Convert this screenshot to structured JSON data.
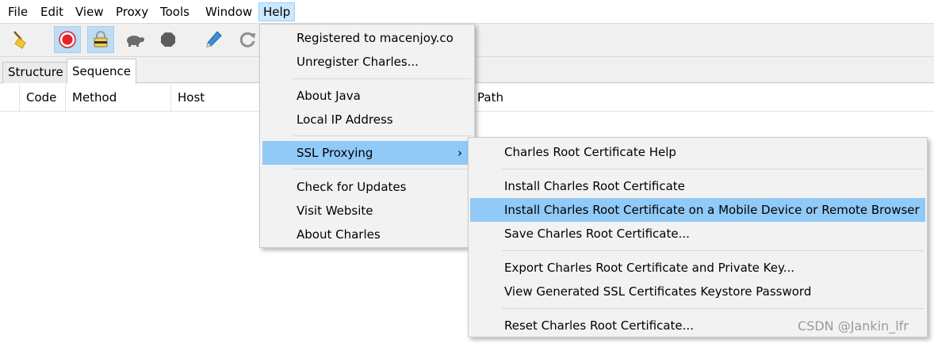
{
  "menubar": {
    "items": [
      "File",
      "Edit",
      "View",
      "Proxy",
      "Tools",
      "Window",
      "Help"
    ],
    "open_item": "Help"
  },
  "toolbar": {
    "buttons": [
      "broom-icon",
      "record-icon",
      "ssl-lock-icon",
      "turtle-icon",
      "hexagon-stop-icon",
      "pen-icon",
      "refresh-icon"
    ]
  },
  "tabs": [
    "Structure",
    "Sequence"
  ],
  "active_tab": "Sequence",
  "table": {
    "columns": [
      "Code",
      "Method",
      "Host",
      "Path"
    ]
  },
  "help_menu": {
    "items": [
      {
        "label": "Registered to macenjoy.co"
      },
      {
        "label": "Unregister Charles..."
      },
      {
        "label": "About Java"
      },
      {
        "label": "Local IP Address"
      },
      {
        "label": "SSL Proxying",
        "submenu_arrow": "›",
        "highlighted": true
      },
      {
        "label": "Check for Updates"
      },
      {
        "label": "Visit Website"
      },
      {
        "label": "About Charles"
      }
    ]
  },
  "ssl_submenu": {
    "items": [
      {
        "label": "Charles Root Certificate Help"
      },
      {
        "label": "Install Charles Root Certificate"
      },
      {
        "label": "Install Charles Root Certificate on a Mobile Device or Remote Browser",
        "highlighted": true
      },
      {
        "label": "Save Charles Root Certificate..."
      },
      {
        "label": "Export Charles Root Certificate and Private Key..."
      },
      {
        "label": "View Generated SSL Certificates Keystore Password"
      },
      {
        "label": "Reset Charles Root Certificate..."
      }
    ]
  },
  "watermark": "CSDN @Jankin_lfr",
  "colors": {
    "highlight": "#91c9f7",
    "open_menu_bg": "#cce8ff",
    "record_red": "#e8212b"
  }
}
